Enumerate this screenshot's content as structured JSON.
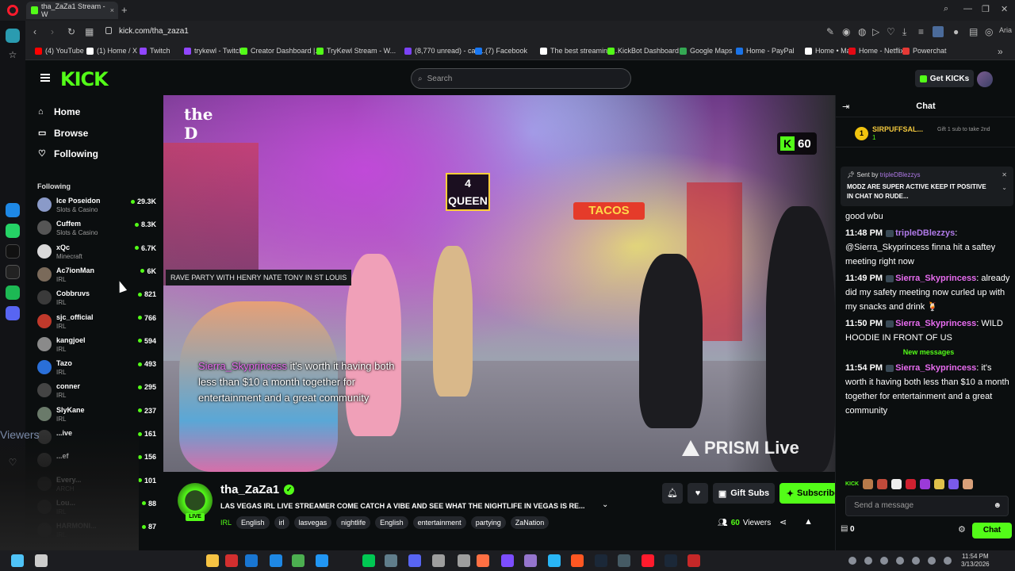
{
  "browser": {
    "tab_title": "tha_ZaZa1 Stream - W",
    "url": "kick.com/tha_zaza1",
    "bookmarks": [
      {
        "label": "(4) YouTube",
        "color": "#ff0000"
      },
      {
        "label": "(1) Home / X",
        "color": "#ffffff"
      },
      {
        "label": "Twitch",
        "color": "#9146ff"
      },
      {
        "label": "trykewl - Twitch",
        "color": "#9146ff"
      },
      {
        "label": "Creator Dashboard |...",
        "color": "#53fc18"
      },
      {
        "label": "TryKewl Stream - W...",
        "color": "#53fc18"
      },
      {
        "label": "(8,770 unread) - carl...",
        "color": "#7b42f5"
      },
      {
        "label": "(7) Facebook",
        "color": "#1877f2"
      },
      {
        "label": "The best streaming...",
        "color": "#ffffff"
      },
      {
        "label": "KickBot Dashboard",
        "color": "#53fc18"
      },
      {
        "label": "Google Maps",
        "color": "#34a853"
      },
      {
        "label": "Home - PayPal",
        "color": "#1a73e8"
      },
      {
        "label": "Home • Max",
        "color": "#ffffff"
      },
      {
        "label": "Home - Netflix",
        "color": "#e50914"
      },
      {
        "label": "Powerchat",
        "color": "#e53935"
      }
    ]
  },
  "header": {
    "logo": "KICK",
    "search_placeholder": "Search",
    "get_kicks": "Get KICKs"
  },
  "nav": {
    "home": "Home",
    "browse": "Browse",
    "following": "Following"
  },
  "following": {
    "title": "Following",
    "channels": [
      {
        "name": "Ice Poseidon",
        "category": "Slots & Casino",
        "viewers": "29.3K",
        "color": "#8a9ac8"
      },
      {
        "name": "Cuffem",
        "category": "Slots & Casino",
        "viewers": "8.3K",
        "color": "#555555"
      },
      {
        "name": "xQc",
        "category": "Minecraft",
        "viewers": "6.7K",
        "color": "#d9d9d9"
      },
      {
        "name": "Ac7ionMan",
        "category": "IRL",
        "viewers": "6K",
        "color": "#7a6a5a"
      },
      {
        "name": "Cobbruvs",
        "category": "IRL",
        "viewers": "821",
        "color": "#3a3a3a"
      },
      {
        "name": "sjc_official",
        "category": "IRL",
        "viewers": "766",
        "color": "#c0392b"
      },
      {
        "name": "kangjoel",
        "category": "IRL",
        "viewers": "594",
        "color": "#8a8a8a"
      },
      {
        "name": "Tazo",
        "category": "IRL",
        "viewers": "493",
        "color": "#2a6fd8"
      },
      {
        "name": "conner",
        "category": "IRL",
        "viewers": "295",
        "color": "#444444"
      },
      {
        "name": "SlyKane",
        "category": "IRL",
        "viewers": "237",
        "color": "#6a7a6a"
      },
      {
        "name": "...ive",
        "category": "",
        "viewers": "161",
        "color": "#333333"
      },
      {
        "name": "...ef",
        "category": "",
        "viewers": "156",
        "color": "#333333"
      },
      {
        "name": "Every...",
        "category": "ARCH",
        "viewers": "101",
        "color": "#333333"
      },
      {
        "name": "Lou...",
        "category": "IRL",
        "viewers": "88",
        "color": "#333333"
      },
      {
        "name": "HARMONI...",
        "category": "IRL",
        "viewers": "87",
        "color": "#333333"
      }
    ]
  },
  "video": {
    "tooltip": "RAVE PARTY WITH HENRY NATE TONY IN ST LOUIS",
    "kick_count": "60",
    "caption_user": "Sierra_Skyprincess",
    "caption_text": "it's worth it having both less than $10 a month together for entertainment and a great community",
    "watermark": "PRISM Live",
    "sign_tacos": "TACOS",
    "sign_queen": "4 QUEEN",
    "sign_d": "the D"
  },
  "stream": {
    "channel": "tha_ZaZa1",
    "live": "LIVE",
    "title": "LAS VEGAS IRL LIVE STREAMER COME CATCH A VIBE AND SEE WHAT THE NIGHTLIFE IN VEGAS IS RE...",
    "category": "IRL",
    "tags": [
      "English",
      "irl",
      "lasvegas",
      "nightlife",
      "English",
      "entertainment",
      "partying",
      "ZaNation"
    ],
    "gift_subs": "Gift Subs",
    "subscribe": "Subscribe",
    "viewer_count": "60",
    "viewers_label": "Viewers"
  },
  "chat": {
    "title": "Chat",
    "leader": {
      "rank": "1",
      "name": "SIRPUFFSAL...",
      "count": "1",
      "gift_note": "Gift 1 sub to take 2nd"
    },
    "pinned": {
      "sent_by": "Sent by",
      "user": "tripleDBlezzys",
      "message": "MODZ ARE SUPER ACTIVE KEEP IT POSITIVE IN CHAT NO RUDE..."
    },
    "messages": [
      {
        "time": "",
        "user": "",
        "text": "good wbu",
        "ucls": ""
      },
      {
        "time": "11:48 PM",
        "user": "tripleDBlezzys",
        "text": ": @Sierra_Skyprincess finna hit a saftey meeting right now",
        "ucls": "u1"
      },
      {
        "time": "11:49 PM",
        "user": "Sierra_Skyprincess",
        "text": ": already did my safety meeting now curled up with my snacks and drink 🍹",
        "ucls": "u2"
      },
      {
        "time": "11:50 PM",
        "user": "Sierra_Skyprincess",
        "text": ": WILD HOODIE IN FRONT OF US",
        "ucls": "u2"
      }
    ],
    "new_messages": "New messages",
    "latest": {
      "time": "11:54 PM",
      "user": "Sierra_Skyprincess",
      "text": ": it's worth it having both less than $10 a month together for entertainment and a great community"
    },
    "emote_label": "KICK",
    "send_placeholder": "Send a message",
    "points": "0",
    "chat_button": "Chat"
  },
  "taskbar": {
    "time": "11:54 PM",
    "date": "3/13/2026"
  },
  "webcam": {
    "label": "Viewers"
  }
}
